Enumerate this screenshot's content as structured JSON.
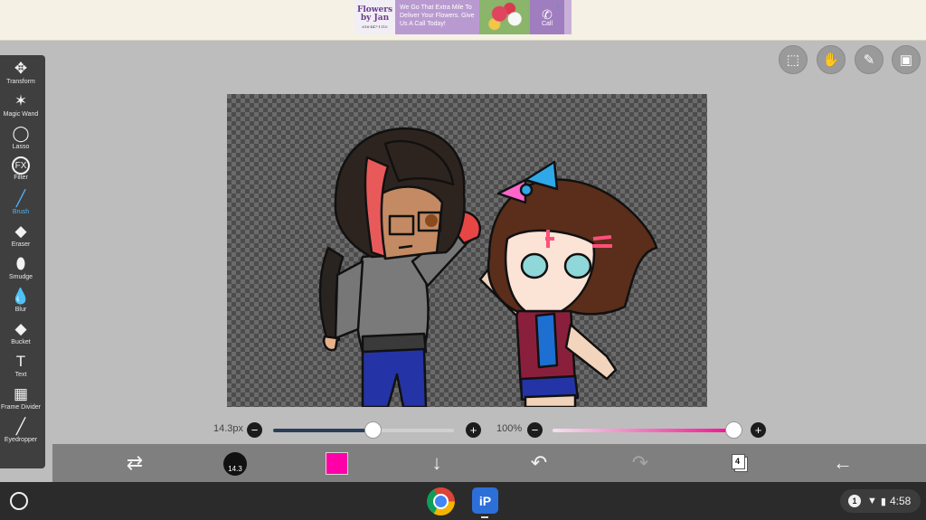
{
  "ad": {
    "logo_line1": "Flowers",
    "logo_line2": "by Jan",
    "logo_phone": "616-447-1110",
    "text": "We Go That Extra Mile To Deliver Your Flowers. Give Us A Call Today!",
    "call_label": "Call"
  },
  "toolbar": {
    "items": [
      {
        "label": "Transform",
        "icon": "move-arrows-icon",
        "glyph": "✥"
      },
      {
        "label": "Magic Wand",
        "icon": "magic-wand-icon",
        "glyph": "✶"
      },
      {
        "label": "Lasso",
        "icon": "lasso-icon",
        "glyph": "◯"
      },
      {
        "label": "Filter",
        "icon": "fx-icon",
        "glyph": "FX"
      },
      {
        "label": "Brush",
        "icon": "brush-icon",
        "glyph": "╱"
      },
      {
        "label": "Eraser",
        "icon": "eraser-icon",
        "glyph": "◆"
      },
      {
        "label": "Smudge",
        "icon": "smudge-icon",
        "glyph": "⬮"
      },
      {
        "label": "Blur",
        "icon": "blur-drop-icon",
        "glyph": "💧"
      },
      {
        "label": "Bucket",
        "icon": "bucket-icon",
        "glyph": "◆"
      },
      {
        "label": "Text",
        "icon": "text-icon",
        "glyph": "T"
      },
      {
        "label": "Frame Divider",
        "icon": "frame-divider-icon",
        "glyph": "▦"
      },
      {
        "label": "Eyedropper",
        "icon": "eyedropper-icon",
        "glyph": "╱"
      }
    ],
    "active": "Brush"
  },
  "top_buttons": [
    {
      "icon": "selection-icon",
      "glyph": "⬚"
    },
    {
      "icon": "hand-icon",
      "glyph": "✋"
    },
    {
      "icon": "ruler-icon",
      "glyph": "✎"
    },
    {
      "icon": "image-icon",
      "glyph": "▣"
    }
  ],
  "sliders": {
    "size_label": "14.3px",
    "size_fraction": 0.55,
    "opacity_label": "100%",
    "opacity_fraction": 1.0,
    "minus": "−",
    "plus": "+"
  },
  "bottom_bar": {
    "brush_size": "14.3",
    "color": "#ff00a8",
    "layers_count": "4",
    "icons": [
      "swap-icon",
      "brush-size-icon",
      "color-swatch",
      "download-icon",
      "undo-icon",
      "redo-icon",
      "layers-icon",
      "back-icon"
    ]
  },
  "system_bar": {
    "notification_count": "1",
    "time": "4:58"
  }
}
